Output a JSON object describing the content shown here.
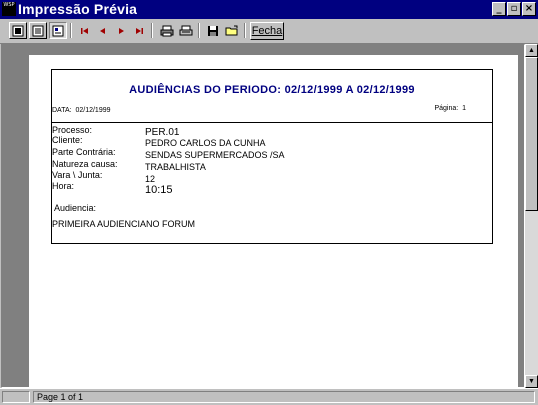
{
  "window": {
    "title": "Impressão Prévia",
    "icon_text": "WSP"
  },
  "toolbar": {
    "icons": [
      "page-view-icon",
      "page-width-icon",
      "zoom-icon",
      "first-page-icon",
      "prev-page-icon",
      "next-page-icon",
      "last-page-icon",
      "print-icon",
      "printer-setup-icon",
      "save-icon",
      "open-icon"
    ],
    "fecha_label": "Fecha"
  },
  "report": {
    "title": "AUDIÊNCIAS DO PERIODO: 02/12/1999 A 02/12/1999",
    "data_label": "DATA:",
    "data_value": "02/12/1999",
    "pagina_label": "Página:",
    "pagina_value": "1",
    "fields": {
      "processo_label": "Processo:",
      "processo_value": "PER.01",
      "cliente_label": "Cliente:",
      "cliente_value": "PEDRO CARLOS DA CUNHA",
      "parte_label": "Parte Contrária:",
      "parte_value": "SENDAS SUPERMERCADOS /SA",
      "natureza_label": "Natureza causa:",
      "natureza_value": "TRABALHISTA",
      "vara_label": "Vara \\ Junta:",
      "vara_value": "12",
      "hora_label": "Hora:",
      "hora_value": "10:15",
      "audiencia_label": "Audiencia:",
      "audiencia_value": "PRIMEIRA AUDIENCIANO FORUM"
    }
  },
  "statusbar": {
    "page_text": "Page 1 of 1"
  }
}
